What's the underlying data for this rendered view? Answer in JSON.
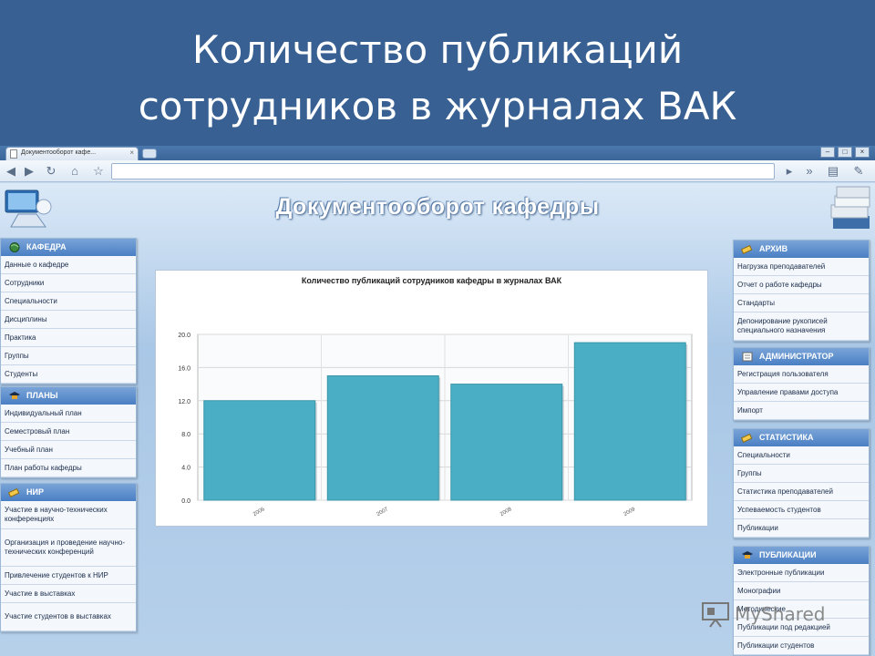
{
  "slide": {
    "title_line1": "Количество публикаций",
    "title_line2": "сотрудников в журналах ВАК",
    "background": "#386092"
  },
  "browser": {
    "tab_title": "Документооборот кафе...",
    "tab_close": "×",
    "window_buttons": [
      "–",
      "□",
      "×"
    ]
  },
  "site": {
    "title": "Документооборот кафедры"
  },
  "left_menus": [
    {
      "title": "КАФЕДРА",
      "items": [
        "Данные о кафедре",
        "Сотрудники",
        "Специальности",
        "Дисциплины",
        "Практика",
        "Группы",
        "Студенты"
      ]
    },
    {
      "title": "ПЛАНЫ",
      "items": [
        "Индивидуальный план",
        "Семестровый план",
        "Учебный план",
        "План работы кафедры"
      ]
    },
    {
      "title": "НИР",
      "items": [
        "Участие в научно-технических конференциях",
        "Организация и проведение научно-технических конференций",
        "Привлечение студентов к НИР",
        "Участие в выставках",
        "Участие студентов в выставках"
      ]
    }
  ],
  "right_menus": [
    {
      "title": "АРХИВ",
      "items": [
        "Нагрузка преподавателей",
        "Отчет о работе кафедры",
        "Стандарты",
        "Депонирование рукописей специального назначения"
      ]
    },
    {
      "title": "АДМИНИСТРАТОР",
      "items": [
        "Регистрация пользователя",
        "Управление правами доступа",
        "Импорт"
      ]
    },
    {
      "title": "СТАТИСТИКА",
      "items": [
        "Специальности",
        "Группы",
        "Статистика преподавателей",
        "Успеваемость студентов",
        "Публикации"
      ]
    },
    {
      "title": "ПУБЛИКАЦИИ",
      "items": [
        "Электронные публикации",
        "Монографии",
        "Методические",
        "Публикации под редакцией",
        "Публикации студентов"
      ]
    }
  ],
  "chart_data": {
    "type": "bar",
    "title": "Количество публикаций сотрудников кафедры в журналах ВАК",
    "categories": [
      "2006",
      "2007",
      "2008",
      "2009"
    ],
    "values": [
      12,
      15,
      14,
      19
    ],
    "ylim": [
      0,
      20
    ],
    "yticks": [
      "0.0",
      "4.0",
      "8.0",
      "12.0",
      "16.0",
      "20.0"
    ],
    "bar_color": "#4aafc4",
    "grid": true
  },
  "watermark": "MyShared"
}
